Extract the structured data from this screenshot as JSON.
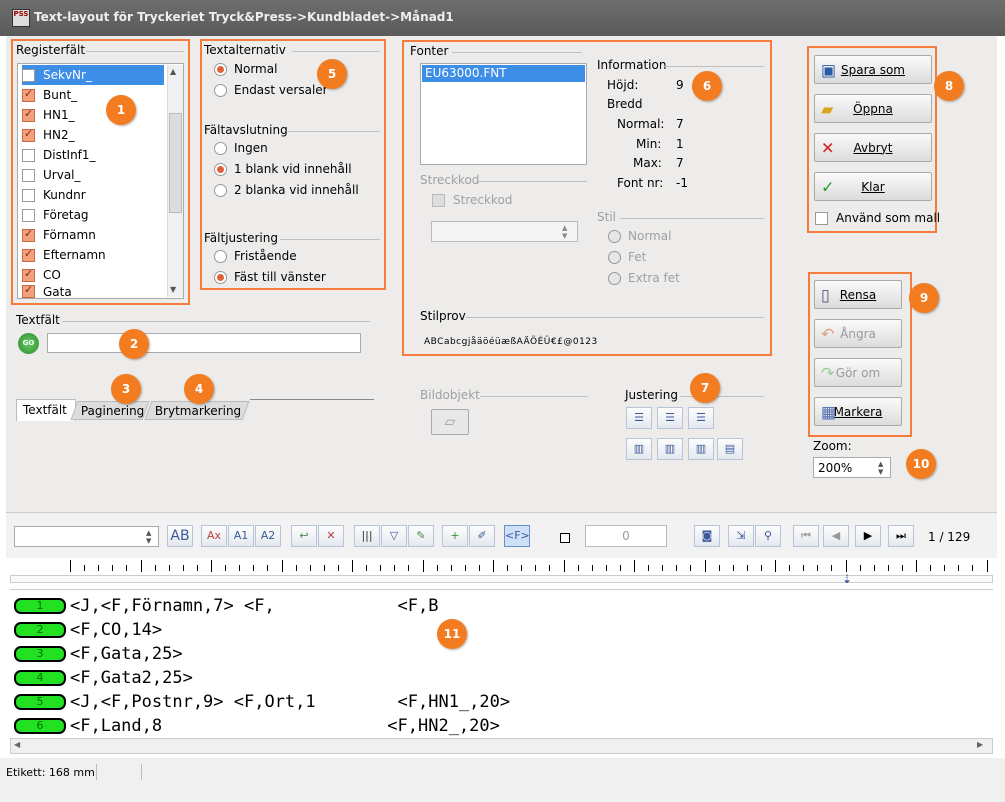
{
  "window": {
    "title": "Text-layout för Tryckeriet Tryck&Press->Kundbladet->Månad1",
    "icon_label": "PSS"
  },
  "registerfalt": {
    "title": "Registerfält",
    "items": [
      {
        "label": "SekvNr_",
        "checked": false,
        "selected": true
      },
      {
        "label": "Bunt_",
        "checked": true
      },
      {
        "label": "HN1_",
        "checked": true
      },
      {
        "label": "HN2_",
        "checked": true
      },
      {
        "label": "DistInf1_",
        "checked": false
      },
      {
        "label": "Urval_",
        "checked": false
      },
      {
        "label": "Kundnr",
        "checked": false
      },
      {
        "label": "Företag",
        "checked": false
      },
      {
        "label": "Förnamn",
        "checked": true
      },
      {
        "label": "Efternamn",
        "checked": true
      },
      {
        "label": "CO",
        "checked": true
      },
      {
        "label": "Gata",
        "checked": true
      }
    ]
  },
  "textalternativ": {
    "title": "Textalternativ",
    "opt1": "Normal",
    "opt2": "Endast versaler"
  },
  "faltavslutning": {
    "title": "Fältavslutning",
    "opt1": "Ingen",
    "opt2": "1 blank vid innehåll",
    "opt3": "2 blanka vid innehåll"
  },
  "faltjustering": {
    "title": "Fältjustering",
    "opt1": "Fristående",
    "opt2": "Fäst till vänster"
  },
  "fonter": {
    "title": "Fonter",
    "font_item": "EU63000.FNT",
    "streckkod_title": "Streckkod",
    "streckkod_label": "Streckkod",
    "info_title": "Information",
    "hojd_label": "Höjd:",
    "hojd_value": "9",
    "bredd_label": "Bredd",
    "normal_label": "Normal:",
    "normal_value": "7",
    "min_label": "Min:",
    "min_value": "1",
    "max_label": "Max:",
    "max_value": "7",
    "fontnr_label": "Font nr:",
    "fontnr_value": "-1",
    "stil_title": "Stil",
    "stil1": "Normal",
    "stil2": "Fet",
    "stil3": "Extra fet",
    "stilprov_title": "Stilprov",
    "stilprov_text": "ABCabcgjåäöéüæßAÄÖÉÜ€£@0123"
  },
  "actions": {
    "save": "Spara som",
    "open": "Öppna",
    "cancel": "Avbryt",
    "ok": "Klar",
    "template": "Använd som mall"
  },
  "edit_actions": {
    "clear": "Rensa",
    "undo": "Ångra",
    "redo": "Gör om",
    "mark": "Markera"
  },
  "textfalt": {
    "title": "Textfält",
    "go": "GO",
    "value": ""
  },
  "tabs": [
    "Textfält",
    "Paginering",
    "Brytmarkering"
  ],
  "bildobjekt": "Bildobjekt",
  "justering": "Justering",
  "zoom": {
    "label": "Zoom:",
    "value": "200%"
  },
  "toolbar": {
    "tb_ab": "AB",
    "tb_ax": "Ax",
    "tb_a1": "A1",
    "tb_a2": "A2",
    "tb_f": "<F>",
    "spin_value": "0",
    "page_counter": "1 / 129"
  },
  "editor_lines": [
    {
      "num": "1",
      "text": "<J,<F,Förnamn,7> <F,            <F,B"
    },
    {
      "num": "2",
      "text": "<F,CO,14>"
    },
    {
      "num": "3",
      "text": "<F,Gata,25>"
    },
    {
      "num": "4",
      "text": "<F,Gata2,25>"
    },
    {
      "num": "5",
      "text": "<J,<F,Postnr,9> <F,Ort,1        <F,HN1_,20>"
    },
    {
      "num": "6",
      "text": "<F,Land,8                      <F,HN2_,20>"
    }
  ],
  "statusbar": {
    "label": "Etikett: 168 mm"
  },
  "badges": [
    "1",
    "2",
    "3",
    "4",
    "5",
    "6",
    "7",
    "8",
    "9",
    "10",
    "11"
  ],
  "colors": {
    "accent": "#f47c3c",
    "selection": "#3d8ee6",
    "line_number_bg": "#22e022"
  }
}
